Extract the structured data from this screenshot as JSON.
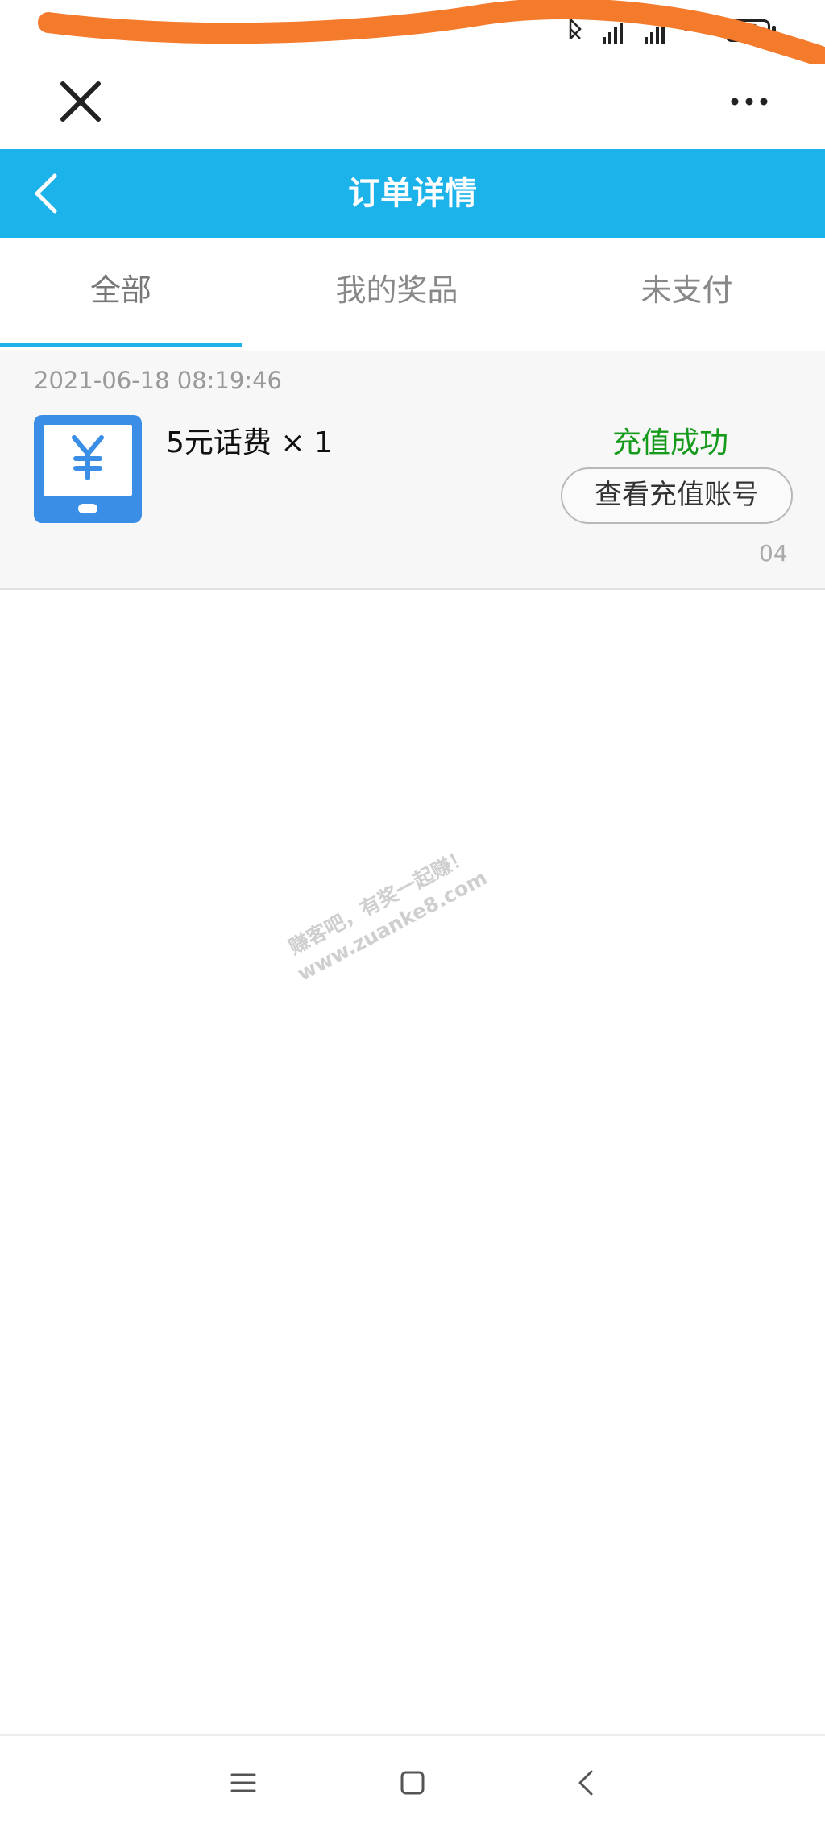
{
  "status_bar": {
    "icons": [
      "bluetooth-icon",
      "signal-hd-icon",
      "signal-hd-icon",
      "wifi-icon",
      "battery-icon"
    ],
    "battery_level": "76"
  },
  "browser": {
    "close_icon": "close-icon",
    "more_icon": "more-dots-icon"
  },
  "header": {
    "title": "订单详情",
    "back_icon": "chevron-left-icon",
    "background_color": "#1cb3ea"
  },
  "tabs": [
    {
      "label": "全部",
      "active": true
    },
    {
      "label": "我的奖品",
      "active": false
    },
    {
      "label": "未支付",
      "active": false
    }
  ],
  "order": {
    "time": "2021-06-18 08:19:46",
    "product_name": "5元话费 × 1",
    "status": "充值成功",
    "status_color": "#159a1b",
    "action_label": "查看充值账号",
    "order_no_tail": "04"
  },
  "watermark": {
    "line1": "赚客吧，有奖一起赚！",
    "line2": "www.zuanke8.com"
  },
  "nav_bar": {
    "icons": [
      "menu-icon",
      "home-square-icon",
      "back-triangle-icon"
    ]
  }
}
